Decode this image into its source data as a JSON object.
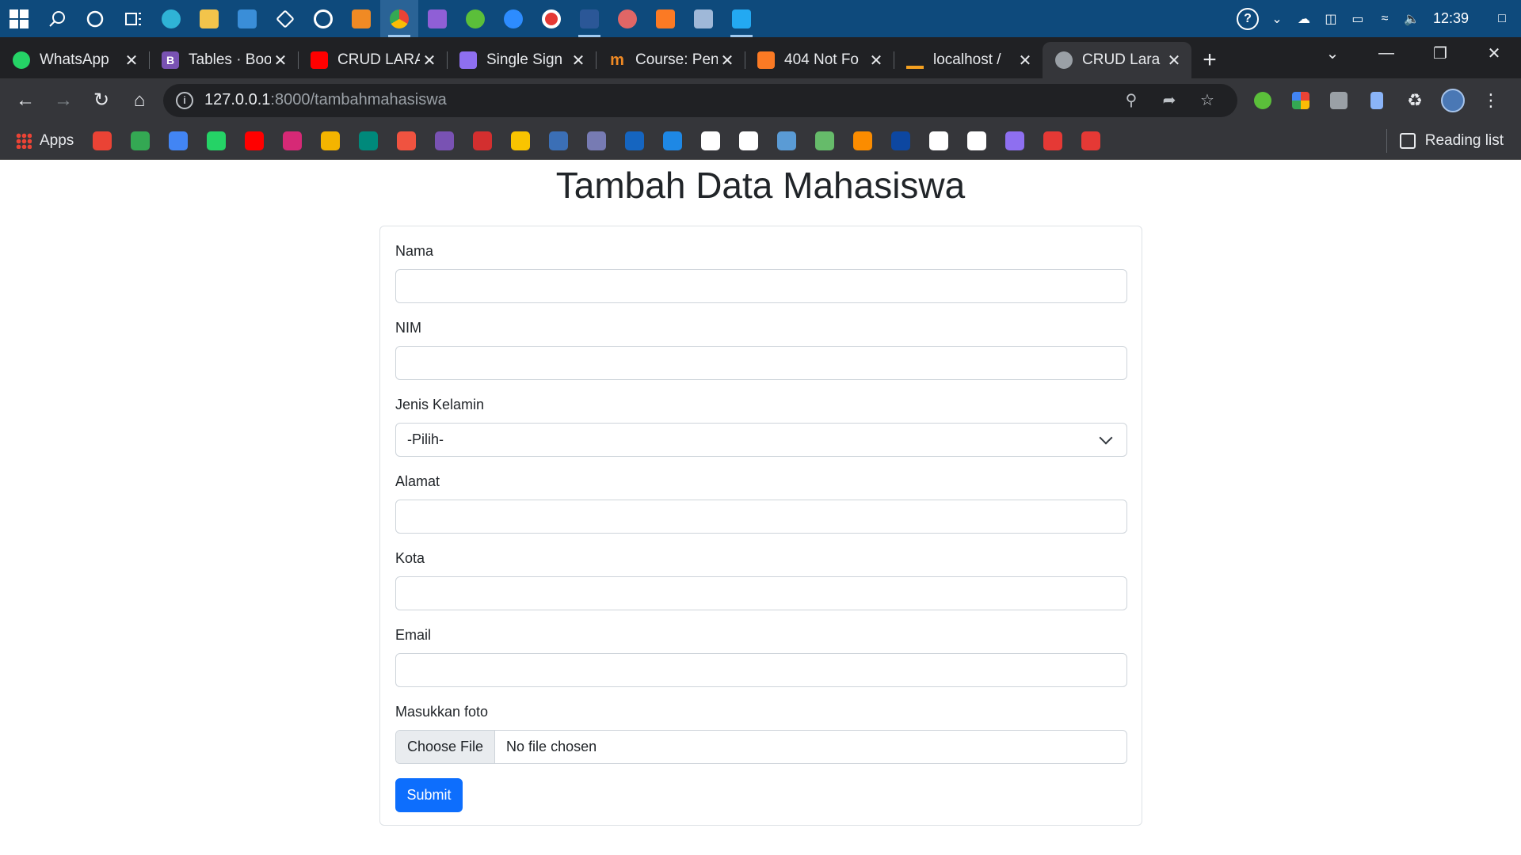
{
  "taskbar": {
    "apps": [
      {
        "name": "start",
        "color": "#ffffff"
      },
      {
        "name": "search",
        "color": "#ffffff"
      },
      {
        "name": "cortana",
        "color": "#ffffff"
      },
      {
        "name": "task-view",
        "color": "#ffffff"
      },
      {
        "name": "edge",
        "color": "#2fb3d6"
      },
      {
        "name": "file-explorer",
        "color": "#f3c44b"
      },
      {
        "name": "mail",
        "color": "#3a8ed8"
      },
      {
        "name": "dropbox",
        "color": "#ffffff"
      },
      {
        "name": "github-desktop",
        "color": "#ffffff"
      },
      {
        "name": "sublime-text",
        "color": "#f08a24"
      },
      {
        "name": "chrome",
        "color": "#34a853"
      },
      {
        "name": "visual-studio",
        "color": "#8f5fd6"
      },
      {
        "name": "maps-app",
        "color": "#5bbf3a"
      },
      {
        "name": "zoom",
        "color": "#2d8cff"
      },
      {
        "name": "screen-recorder",
        "color": "#e53935"
      },
      {
        "name": "word",
        "color": "#2b5797"
      },
      {
        "name": "paint-app",
        "color": "#e06666"
      },
      {
        "name": "xampp",
        "color": "#fb7a24"
      },
      {
        "name": "notes-app",
        "color": "#9fb8d8"
      },
      {
        "name": "vscode",
        "color": "#23a9f2"
      }
    ],
    "clock": "12:39"
  },
  "tabs": [
    {
      "title": "WhatsApp",
      "color": "#25d366",
      "letter": ""
    },
    {
      "title": "Tables · Boo",
      "color": "#7952b3",
      "letter": "B"
    },
    {
      "title": "CRUD LARA",
      "color": "#ff0000",
      "letter": ""
    },
    {
      "title": "Single Sign",
      "color": "#8e6ff0",
      "letter": ""
    },
    {
      "title": "Course: Pen",
      "color": "#f08a24",
      "letter": "m"
    },
    {
      "title": "404 Not Fo",
      "color": "#fb7a24",
      "letter": ""
    },
    {
      "title": "localhost /",
      "color": "#f4a020",
      "letter": ""
    },
    {
      "title": "CRUD Lara",
      "color": "#9aa0a6",
      "letter": ""
    }
  ],
  "addressbar": {
    "url_host": "127.0.0.1",
    "url_rest": ":8000/tambahmahasiswa"
  },
  "bookmarks": {
    "apps_label": "Apps",
    "reading_list": "Reading list",
    "items": [
      {
        "name": "gmail",
        "color": "#ea4335"
      },
      {
        "name": "google-drive",
        "color": "#34a853"
      },
      {
        "name": "google",
        "color": "#4285f4"
      },
      {
        "name": "whatsapp-62",
        "color": "#25d366"
      },
      {
        "name": "youtube",
        "color": "#ff0000"
      },
      {
        "name": "instagram",
        "color": "#d62976"
      },
      {
        "name": "classroom",
        "color": "#f4b400"
      },
      {
        "name": "meet",
        "color": "#00897b"
      },
      {
        "name": "laravel",
        "color": "#f05340"
      },
      {
        "name": "bootstrap",
        "color": "#7952b3"
      },
      {
        "name": "mendeley",
        "color": "#d32f2f"
      },
      {
        "name": "shield-site",
        "color": "#f9c400"
      },
      {
        "name": "fx-site",
        "color": "#3b6fb6"
      },
      {
        "name": "php-site",
        "color": "#777bb3"
      },
      {
        "name": "blue-circle-site",
        "color": "#1565c0"
      },
      {
        "name": "gear-site",
        "color": "#1e88e5"
      },
      {
        "name": "codepen",
        "color": "#ffffff"
      },
      {
        "name": "github",
        "color": "#ffffff"
      },
      {
        "name": "nine-site",
        "color": "#5a9bd5"
      },
      {
        "name": "atom-site",
        "color": "#66bb6a"
      },
      {
        "name": "rainbow-site",
        "color": "#fb8c00"
      },
      {
        "name": "globe-site",
        "color": "#0d47a1"
      },
      {
        "name": "steps-site",
        "color": "#ffffff"
      },
      {
        "name": "wix",
        "color": "#ffffff"
      },
      {
        "name": "sso-site",
        "color": "#8e6ff0"
      },
      {
        "name": "mailbox-site",
        "color": "#e53935"
      },
      {
        "name": "red-site",
        "color": "#e53935"
      }
    ]
  },
  "page": {
    "title": "Tambah Data Mahasiswa",
    "fields": {
      "nama_label": "Nama",
      "nim_label": "NIM",
      "jk_label": "Jenis Kelamin",
      "jk_selected": "-Pilih-",
      "alamat_label": "Alamat",
      "kota_label": "Kota",
      "email_label": "Email",
      "foto_label": "Masukkan foto",
      "choose_file": "Choose File",
      "no_file": "No file chosen"
    },
    "submit_label": "Submit",
    "primary_color": "#0d6efd"
  }
}
